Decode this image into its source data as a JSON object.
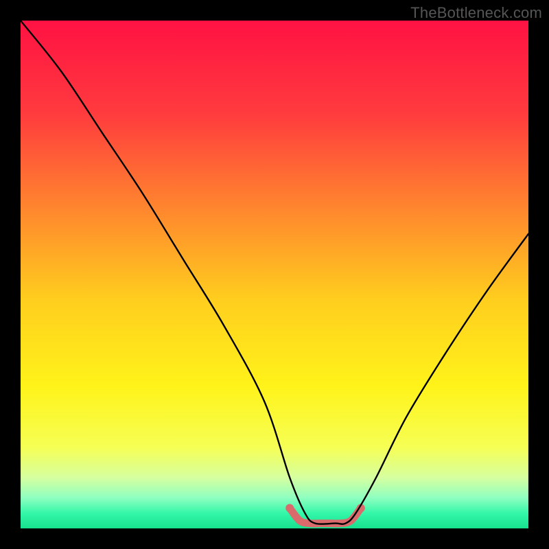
{
  "watermark": "TheBottleneck.com",
  "chart_data": {
    "type": "line",
    "title": "",
    "xlabel": "",
    "ylabel": "",
    "xlim": [
      0,
      100
    ],
    "ylim": [
      0,
      100
    ],
    "series": [
      {
        "name": "bottleneck-curve",
        "x": [
          0,
          8,
          16,
          24,
          32,
          40,
          48,
          53,
          56,
          58,
          62,
          64,
          66,
          70,
          76,
          84,
          92,
          100
        ],
        "y": [
          100,
          90,
          78,
          66,
          53,
          40,
          25,
          10,
          3,
          1,
          1,
          1,
          3,
          10,
          22,
          35,
          47,
          58
        ]
      },
      {
        "name": "sweet-spot-band",
        "x": [
          53,
          55,
          57,
          59,
          61,
          63,
          65,
          67
        ],
        "y": [
          4,
          1.5,
          1,
          1,
          1,
          1,
          1.5,
          4
        ]
      }
    ],
    "gradient_stops": [
      {
        "pos": 0.0,
        "color": "#ff1243"
      },
      {
        "pos": 0.18,
        "color": "#ff3a3e"
      },
      {
        "pos": 0.38,
        "color": "#ff8a2d"
      },
      {
        "pos": 0.55,
        "color": "#ffce1e"
      },
      {
        "pos": 0.72,
        "color": "#fff31a"
      },
      {
        "pos": 0.84,
        "color": "#f6ff54"
      },
      {
        "pos": 0.9,
        "color": "#d6ffa0"
      },
      {
        "pos": 0.94,
        "color": "#8effc0"
      },
      {
        "pos": 0.97,
        "color": "#34f7a9"
      },
      {
        "pos": 1.0,
        "color": "#16e08e"
      }
    ],
    "sweet_spot_color": "#d96b6c",
    "curve_color": "#000000"
  }
}
